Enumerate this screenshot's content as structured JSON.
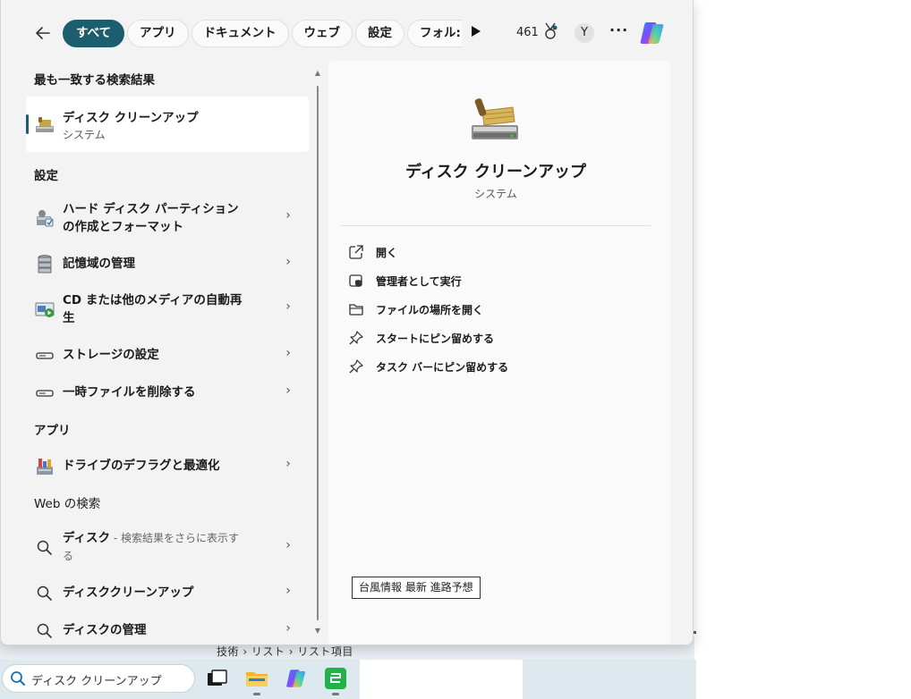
{
  "filters": {
    "chips": [
      "すべて",
      "アプリ",
      "ドキュメント",
      "ウェブ",
      "設定",
      "フォル:"
    ],
    "active_index": 0
  },
  "header": {
    "points": "461",
    "avatar_initial": "Y",
    "more_label": "···"
  },
  "best_match": {
    "section_title": "最も一致する検索結果",
    "name": "ディスク クリーンアップ",
    "sub": "システム"
  },
  "settings": {
    "section_title": "設定",
    "items": [
      {
        "line1": "ハード ディスク パーティション",
        "line2": "の作成とフォーマット",
        "icon": "disk-partition-icon"
      },
      {
        "line1": "記憶域の管理",
        "line2": "",
        "icon": "storage-spaces-icon"
      },
      {
        "line1": "CD または他のメディアの自動再",
        "line2": "生",
        "icon": "autoplay-icon"
      },
      {
        "line1": "ストレージの設定",
        "line2": "",
        "icon": "drive-icon"
      },
      {
        "line1": "一時ファイルを削除する",
        "line2": "",
        "icon": "drive-icon"
      }
    ]
  },
  "apps": {
    "section_title": "アプリ",
    "items": [
      {
        "label": "ドライブのデフラグと最適化",
        "icon": "defrag-icon"
      }
    ]
  },
  "web": {
    "section_title": "Web の検索",
    "items": [
      {
        "bold": "ディスク",
        "dim": " - 検索結果をさらに表示す",
        "dim2": "る",
        "icon": "search-icon"
      },
      {
        "bold": "ディスククリーンアップ",
        "dim": "",
        "dim2": "",
        "icon": "search-icon"
      },
      {
        "bold": "ディスクの管理",
        "dim": "",
        "dim2": "",
        "icon": "search-icon"
      }
    ]
  },
  "preview": {
    "title": "ディスク クリーンアップ",
    "subtitle": "システム",
    "actions": [
      {
        "label": "開く",
        "icon": "open-external-icon"
      },
      {
        "label": "管理者として実行",
        "icon": "shield-icon"
      },
      {
        "label": "ファイルの場所を開く",
        "icon": "folder-icon"
      },
      {
        "label": "スタートにピン留めする",
        "icon": "pin-icon"
      },
      {
        "label": "タスク バーにピン留めする",
        "icon": "pin-icon"
      }
    ],
    "trending": "台風情報 最新 進路予想"
  },
  "taskbar": {
    "search_value": "ディスク クリーンアップ"
  },
  "background_window": {
    "breadcrumb": "技術 › リスト › リスト項目"
  },
  "colors": {
    "accent": "#1d5e6e",
    "panel_bg": "#f3f3f3",
    "taskbar_bg": "#dde9ef"
  }
}
